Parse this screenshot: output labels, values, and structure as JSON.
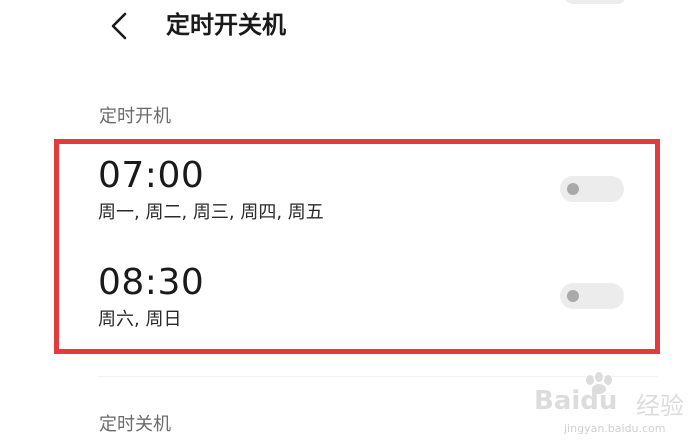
{
  "header": {
    "title": "定时开关机",
    "back_icon": "chevron-left-icon"
  },
  "sections": {
    "power_on": {
      "label": "定时开机",
      "schedules": [
        {
          "time": "07:00",
          "days": "周一, 周二, 周三, 周四, 周五",
          "enabled": false
        },
        {
          "time": "08:30",
          "days": "周六, 周日",
          "enabled": false
        }
      ]
    },
    "power_off": {
      "label": "定时关机"
    }
  },
  "colors": {
    "highlight_border": "#e23a3f",
    "toggle_off_track": "#ececec",
    "toggle_off_knob": "#a9a9a9",
    "section_label": "#6b6b6b"
  },
  "watermark": {
    "logo": "Baidu",
    "text": "经验",
    "url": "jingyan.baidu.com"
  }
}
